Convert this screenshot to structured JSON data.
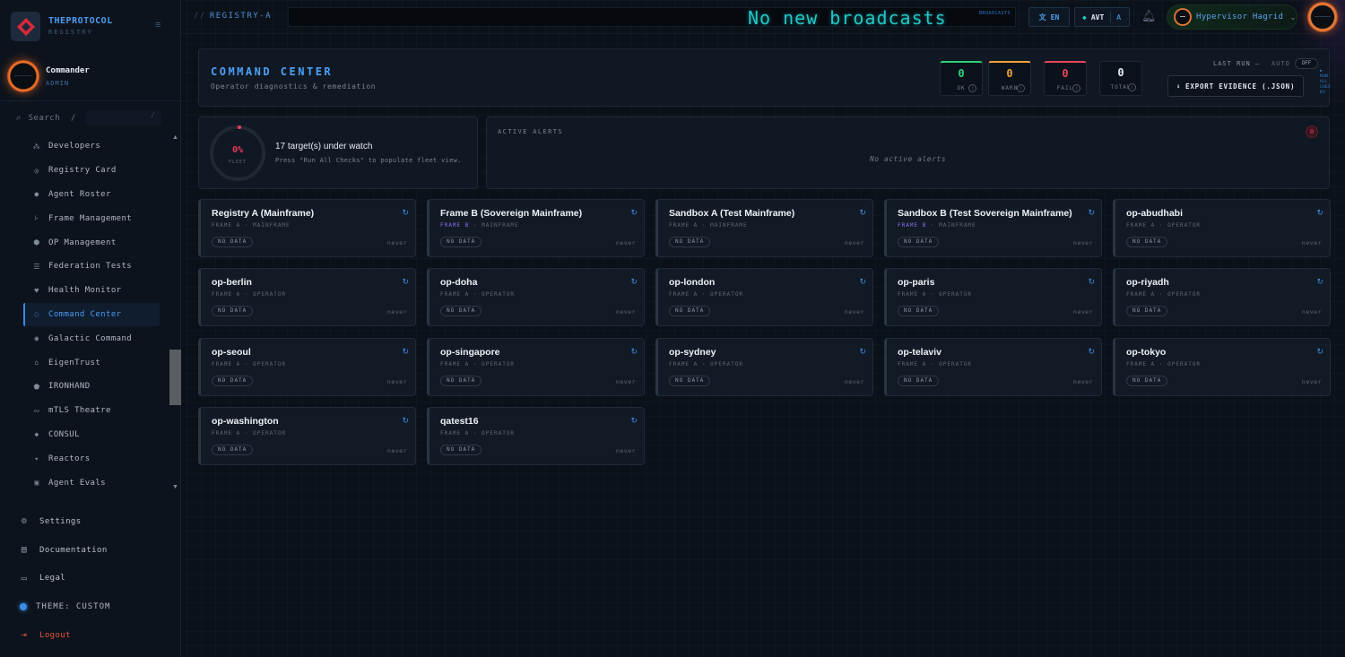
{
  "brand": {
    "name": "THEPROTOCOL",
    "sub": "REGISTRY"
  },
  "user": {
    "name": "Commander",
    "role": "ADMIN"
  },
  "search": {
    "label": "Search",
    "shortcut": "/",
    "key": "/"
  },
  "sidebar": {
    "items": [
      {
        "label": "Developers",
        "icon": "developers-icon",
        "glyph": "⁂"
      },
      {
        "label": "Registry Card",
        "icon": "registry-card-icon",
        "glyph": "◎"
      },
      {
        "label": "Agent Roster",
        "icon": "agent-roster-icon",
        "glyph": "●"
      },
      {
        "label": "Frame Management",
        "icon": "frame-management-icon",
        "glyph": "⊦"
      },
      {
        "label": "OP Management",
        "icon": "op-management-icon",
        "glyph": "⬢"
      },
      {
        "label": "Federation Tests",
        "icon": "federation-tests-icon",
        "glyph": "☰"
      },
      {
        "label": "Health Monitor",
        "icon": "health-monitor-icon",
        "glyph": "♥"
      },
      {
        "label": "Command Center",
        "icon": "command-center-icon",
        "glyph": "◌",
        "active": true
      },
      {
        "label": "Galactic Command",
        "icon": "galactic-command-icon",
        "glyph": "◉"
      },
      {
        "label": "EigenTrust",
        "icon": "eigentrust-icon",
        "glyph": "⌂"
      },
      {
        "label": "IRONHAND",
        "icon": "ironhand-icon",
        "glyph": "⬟"
      },
      {
        "label": "mTLS Theatre",
        "icon": "mtls-theatre-icon",
        "glyph": "∾"
      },
      {
        "label": "CONSUL",
        "icon": "consul-icon",
        "glyph": "◆"
      },
      {
        "label": "Reactors",
        "icon": "reactors-icon",
        "glyph": "✦"
      },
      {
        "label": "Agent Evals",
        "icon": "agent-evals-icon",
        "glyph": "▣"
      }
    ],
    "bottom": {
      "settings": "Settings",
      "documentation": "Documentation",
      "legal": "Legal",
      "theme": "THEME: CUSTOM",
      "logout": "Logout"
    }
  },
  "topbar": {
    "breadcrumb": "REGISTRY-A",
    "breadcrumb_prefix": "//",
    "broadcast": "No new broadcasts",
    "broadcast_tag": "BROADCASTS",
    "lang": "EN",
    "avt": "AVT",
    "avt_suffix": "A",
    "account": "Hypervisor Hagrid"
  },
  "command_center": {
    "title": "COMMAND CENTER",
    "subtitle": "Operator diagnostics & remediation",
    "stats": [
      {
        "key": "ok",
        "value": "0",
        "label": "OK",
        "color": "#2fd37a"
      },
      {
        "key": "warn",
        "value": "0",
        "label": "WARN",
        "color": "#f0a23a"
      },
      {
        "key": "fail",
        "value": "0",
        "label": "FAIL",
        "color": "#e8455c"
      },
      {
        "key": "total",
        "value": "0",
        "label": "TOTAL",
        "color": "#e5ecf4"
      }
    ],
    "last_run": "LAST RUN —",
    "auto": "AUTO",
    "auto_state": "OFF",
    "run_all": "RUN ALL CHECKS",
    "export": "EXPORT EVIDENCE (.JSON)"
  },
  "fleet": {
    "percent": "0%",
    "label": "FLEET",
    "title": "17 target(s) under watch",
    "hint": "Press \"Run All Checks\" to populate fleet view."
  },
  "alerts": {
    "title": "ACTIVE ALERTS",
    "count": "0",
    "empty": "No active alerts"
  },
  "targets": [
    {
      "name": "Registry A (Mainframe)",
      "frame": "FRAME A",
      "kind": "MAINFRAME",
      "status": "NO DATA",
      "last": "never"
    },
    {
      "name": "Frame B (Sovereign Mainframe)",
      "frame": "FRAME B",
      "kind": "MAINFRAME",
      "status": "NO DATA",
      "last": "never",
      "frame_b": true
    },
    {
      "name": "Sandbox A (Test Mainframe)",
      "frame": "FRAME A",
      "kind": "MAINFRAME",
      "status": "NO DATA",
      "last": "never"
    },
    {
      "name": "Sandbox B (Test Sovereign Mainframe)",
      "frame": "FRAME B",
      "kind": "MAINFRAME",
      "status": "NO DATA",
      "last": "never",
      "frame_b": true
    },
    {
      "name": "op-abudhabi",
      "frame": "FRAME A",
      "kind": "OPERATOR",
      "status": "NO DATA",
      "last": "never"
    },
    {
      "name": "op-berlin",
      "frame": "FRAME A",
      "kind": "OPERATOR",
      "status": "NO DATA",
      "last": "never"
    },
    {
      "name": "op-doha",
      "frame": "FRAME A",
      "kind": "OPERATOR",
      "status": "NO DATA",
      "last": "never"
    },
    {
      "name": "op-london",
      "frame": "FRAME A",
      "kind": "OPERATOR",
      "status": "NO DATA",
      "last": "never"
    },
    {
      "name": "op-paris",
      "frame": "FRAME A",
      "kind": "OPERATOR",
      "status": "NO DATA",
      "last": "never"
    },
    {
      "name": "op-riyadh",
      "frame": "FRAME A",
      "kind": "OPERATOR",
      "status": "NO DATA",
      "last": "never"
    },
    {
      "name": "op-seoul",
      "frame": "FRAME A",
      "kind": "OPERATOR",
      "status": "NO DATA",
      "last": "never"
    },
    {
      "name": "op-singapore",
      "frame": "FRAME A",
      "kind": "OPERATOR",
      "status": "NO DATA",
      "last": "never"
    },
    {
      "name": "op-sydney",
      "frame": "FRAME A",
      "kind": "OPERATOR",
      "status": "NO DATA",
      "last": "never"
    },
    {
      "name": "op-telaviv",
      "frame": "FRAME A",
      "kind": "OPERATOR",
      "status": "NO DATA",
      "last": "never"
    },
    {
      "name": "op-tokyo",
      "frame": "FRAME A",
      "kind": "OPERATOR",
      "status": "NO DATA",
      "last": "never"
    },
    {
      "name": "op-washington",
      "frame": "FRAME A",
      "kind": "OPERATOR",
      "status": "NO DATA",
      "last": "never"
    },
    {
      "name": "qatest16",
      "frame": "FRAME A",
      "kind": "OPERATOR",
      "status": "NO DATA",
      "last": "never"
    }
  ]
}
